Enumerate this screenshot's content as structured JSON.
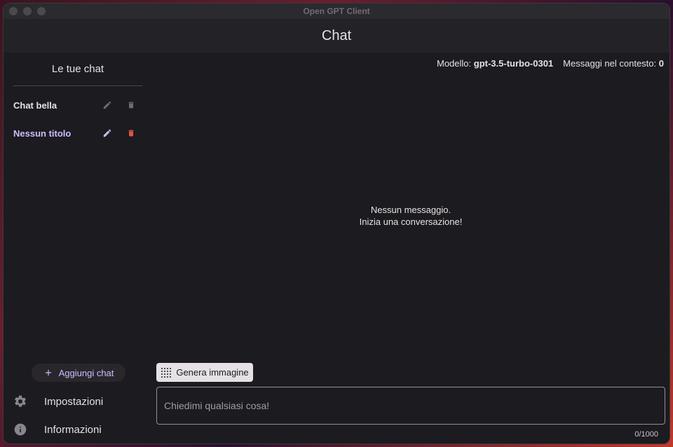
{
  "window": {
    "title": "Open GPT Client"
  },
  "appbar": {
    "title": "Chat"
  },
  "sidebar": {
    "header": "Le tue chat",
    "chats": [
      {
        "label": "Chat bella",
        "active": false
      },
      {
        "label": "Nessun titolo",
        "active": true
      }
    ],
    "add_chat_label": "Aggiungi chat",
    "nav": [
      {
        "label": "Impostazioni",
        "icon": "gear-icon"
      },
      {
        "label": "Informazioni",
        "icon": "info-icon"
      }
    ]
  },
  "status": {
    "model_label": "Modello:",
    "model_value": "gpt-3.5-turbo-0301",
    "context_label": "Messaggi nel contesto:",
    "context_value": "0"
  },
  "empty_state": {
    "line1": "Nessun messaggio.",
    "line2": "Inizia una conversazione!"
  },
  "composer": {
    "generate_image_label": "Genera immagine",
    "placeholder": "Chiedimi qualsiasi cosa!",
    "counter": "0/1000"
  },
  "colors": {
    "accent": "#cfbcff",
    "danger": "#e5534b",
    "surface": "#1c1b1f"
  }
}
